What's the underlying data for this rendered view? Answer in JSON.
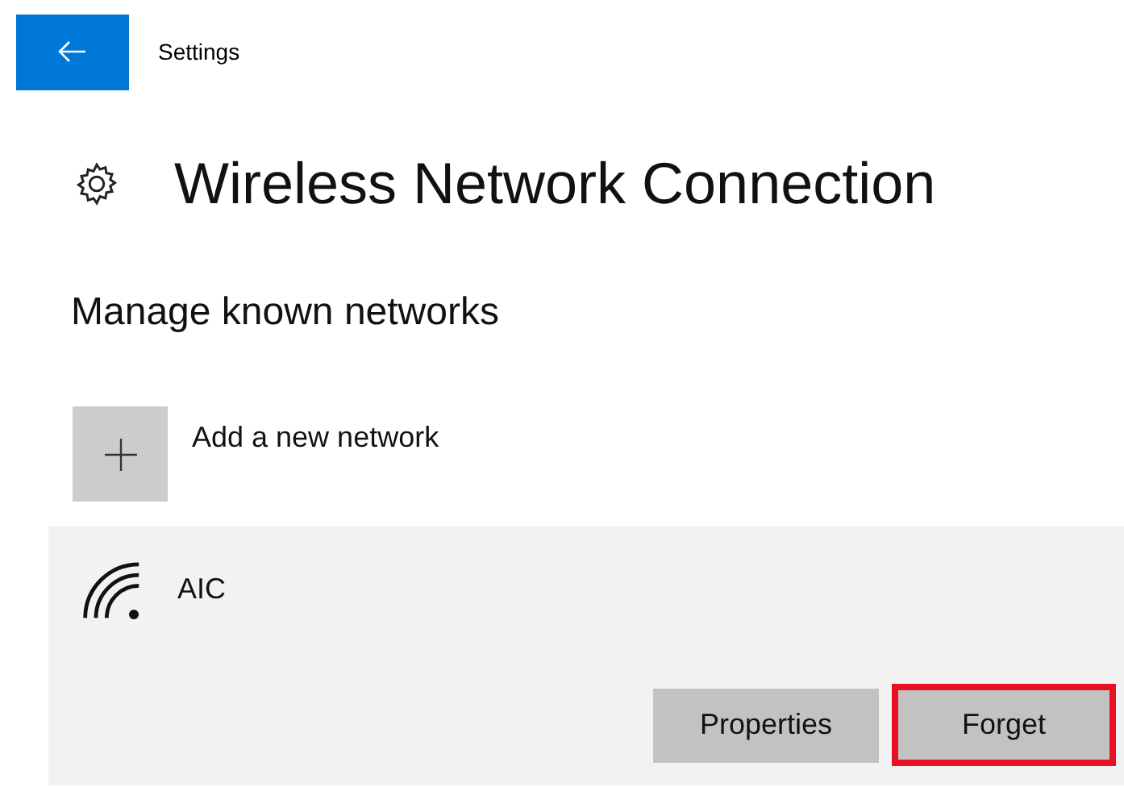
{
  "header": {
    "title": "Settings"
  },
  "page_title": "Wireless Network Connection",
  "section_title": "Manage known networks",
  "add_network": {
    "label": "Add a new network"
  },
  "networks": [
    {
      "name": "AIC",
      "expanded": true,
      "buttons": [
        {
          "label": "Properties",
          "highlighted": false
        },
        {
          "label": "Forget",
          "highlighted": true
        }
      ]
    }
  ]
}
